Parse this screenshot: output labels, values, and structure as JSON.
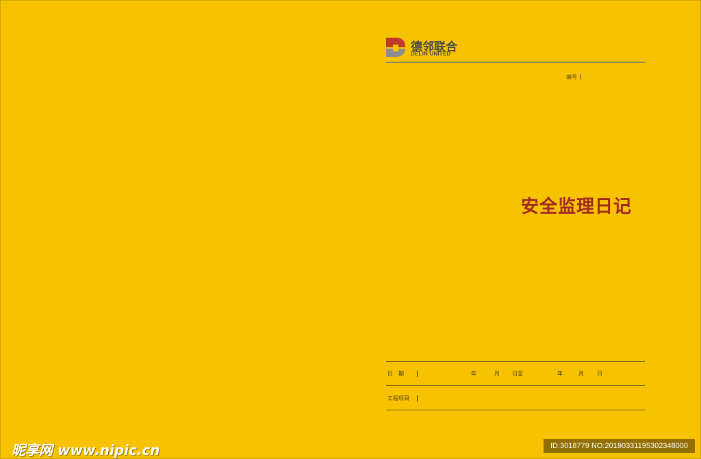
{
  "brand": {
    "name_cn": "德邻联合",
    "name_en": "DELIN UNITED",
    "colors": {
      "mark_red": "#c0392b",
      "mark_gray": "#8c8c8c",
      "text_gray": "#4a4a4a"
    }
  },
  "serial": {
    "label": "编号"
  },
  "title": "安全监理日记",
  "date_row": {
    "label": "日　期",
    "year1": "年",
    "month1": "月",
    "day_to": "日至",
    "year2": "年",
    "month2": "月",
    "day2": "日"
  },
  "project_row": {
    "label": "工程项目"
  },
  "watermark": {
    "left": "昵享网 www.nipic.cn",
    "right": "ID:3018779 NO:20190331195302348000"
  },
  "colors": {
    "background": "#f7c300",
    "title": "#a0281e"
  }
}
